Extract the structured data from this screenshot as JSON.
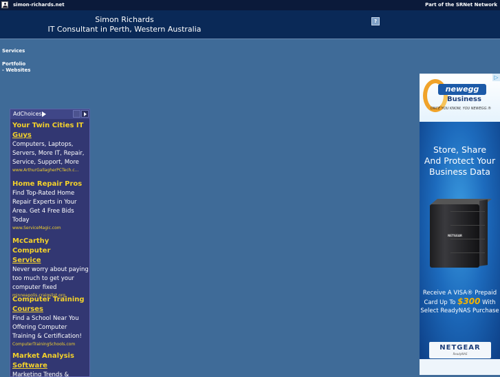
{
  "topbar": {
    "site_name": "simon-richards.net",
    "network_text": "Part of the SRNet Network"
  },
  "header": {
    "name": "Simon Richards",
    "tagline": "IT Consultant in Perth, Western Australia",
    "help_icon": "?"
  },
  "nav": {
    "items": [
      {
        "label": "Services"
      },
      {
        "label": "Portfolio"
      },
      {
        "label": "- Websites"
      }
    ]
  },
  "ads": {
    "adchoices_label": "AdChoices",
    "items": [
      {
        "title_line1": "Your Twin Cities IT",
        "title_line2": "Guys",
        "description": "Computers, Laptops, Servers, More IT, Repair, Service, Support, More",
        "url": "www.ArthurGallagherPCTech.c..."
      },
      {
        "title_line1": "Home Repair Pros",
        "title_line2": "",
        "description": "Find Top-Rated Home Repair Experts in Your Area. Get 4 Free Bids Today",
        "url": "www.ServiceMagic.com"
      },
      {
        "title_line1": "McCarthy Computer",
        "title_line2": "Service",
        "description": "Never worry about paying too much to get your computer fixed",
        "url": "minneapolis.craigslist.org"
      },
      {
        "title_line1": "Computer Training",
        "title_line2": "Courses",
        "description": "Find a School Near You Offering Computer Training & Certification!",
        "url": "ComputerTrainingSchools.com"
      },
      {
        "title_line1": "Market Analysis",
        "title_line2": "Software",
        "description": "Marketing Trends &",
        "url": ""
      }
    ]
  },
  "banner": {
    "brand": "newegg",
    "brand_sub": "Business",
    "slogan": "ONCE YOU KNOW, YOU NEWEGG.®",
    "headline_lines": [
      "Store, Share",
      "And Protect Your",
      "Business Data"
    ],
    "device_label": "NETGEAR",
    "offer_line1": "Receive A VISA® Prepaid",
    "offer_line2_pre": "Card Up To",
    "offer_amount": "$300",
    "offer_line2_post": "With",
    "offer_line3": "Select ReadyNAS Purchase",
    "partner_name": "NETGEAR",
    "partner_sub": "ReadyNAS",
    "close_icon": "▷"
  }
}
